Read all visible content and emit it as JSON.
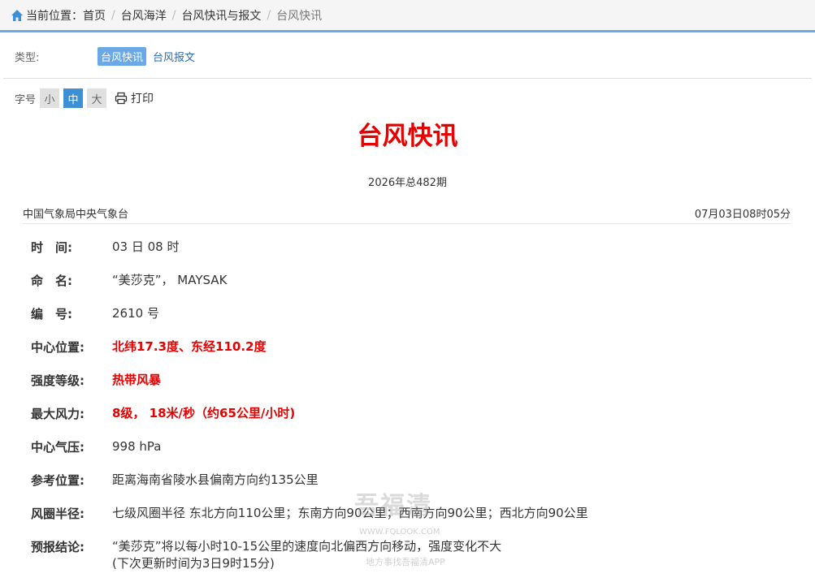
{
  "breadcrumb": {
    "prefix": "当前位置：",
    "items": [
      "首页",
      "台风海洋",
      "台风快讯与报文",
      "台风快讯"
    ]
  },
  "type_filter": {
    "label": "类型:",
    "tags": [
      {
        "label": "台风快讯",
        "active": true
      },
      {
        "label": "台风报文",
        "active": false
      }
    ]
  },
  "font_size": {
    "label": "字号",
    "options": [
      "小",
      "中",
      "大"
    ],
    "selected": "中",
    "print_label": "打印"
  },
  "article": {
    "title": "台风快讯",
    "issue": "2026年总482期",
    "source": "中国气象局中央气象台",
    "timestamp": "07月03日08时05分",
    "rows": [
      {
        "key": "时　间:",
        "value": "03 日 08 时"
      },
      {
        "key": "命　名:",
        "value": "“美莎克”， MAYSAK"
      },
      {
        "key": "编　号:",
        "value": "2610 号"
      },
      {
        "key": "中心位置:",
        "value": "北纬17.3度、东经110.2度"
      },
      {
        "key": "强度等级:",
        "value": "热带风暴"
      },
      {
        "key": "最大风力:",
        "value": "8级， 18米/秒（约65公里/小时)"
      },
      {
        "key": "中心气压:",
        "value": "998 hPa"
      },
      {
        "key": "参考位置:",
        "value": "距离海南省陵水县偏南方向约135公里"
      },
      {
        "key": "风圈半径:",
        "value": "七级风圈半径 东北方向110公里；东南方向90公里；西南方向90公里；西北方向90公里"
      },
      {
        "key": "预报结论:",
        "value": "“美莎克”将以每小时10-15公里的速度向北偏西方向移动，强度变化不大",
        "value2": "(下次更新时间为3日9时15分)"
      }
    ]
  },
  "watermark": {
    "big": "吾福清",
    "small": "WWW.FQLOOK.COM",
    "small2": "地方事找吾福清APP"
  },
  "colors": {
    "accent": "#6aa8e6",
    "highlight_red": "#e60000",
    "active_font": "#3d8fd6"
  }
}
